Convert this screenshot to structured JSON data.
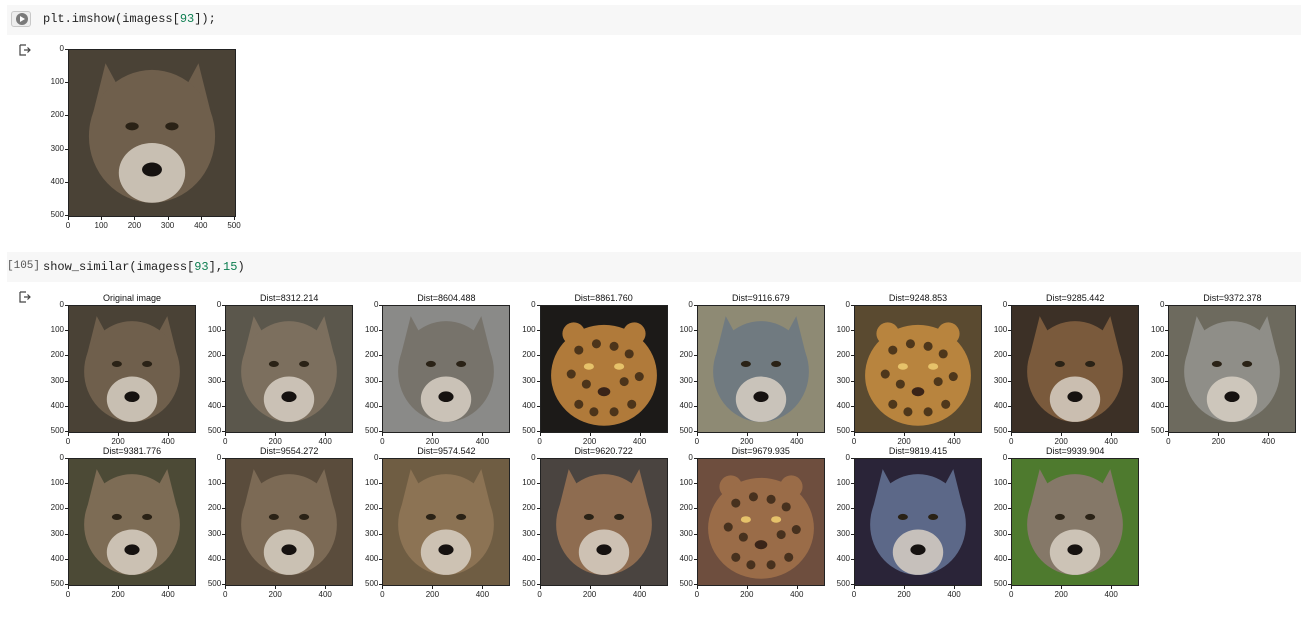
{
  "cells": [
    {
      "exec_count": "",
      "code": {
        "fn": "plt.imshow(imagess[",
        "num": "93",
        "rest": "]);"
      },
      "output": {
        "y_ticks": [
          "0",
          "100",
          "200",
          "300",
          "400",
          "500"
        ],
        "x_ticks": [
          "0",
          "100",
          "200",
          "300",
          "400",
          "500"
        ]
      }
    },
    {
      "exec_count": "[105]",
      "code": {
        "fn": "show_similar(imagess[",
        "num": "93",
        "mid": "],",
        "num2": "15",
        "rest": ")"
      },
      "output": {
        "y_ticks": [
          "0",
          "100",
          "200",
          "300",
          "400",
          "500"
        ],
        "x_ticks": [
          "0",
          "200",
          "400"
        ],
        "panels": [
          {
            "title": "Original image",
            "animal": "wolf",
            "fur": "#6f5f4c",
            "bg": "#4a4236"
          },
          {
            "title": "Dist=8312.214",
            "animal": "wolf",
            "fur": "#7c6f5e",
            "bg": "#5b574c"
          },
          {
            "title": "Dist=8604.488",
            "animal": "wolf",
            "fur": "#77736b",
            "bg": "#8a8a88"
          },
          {
            "title": "Dist=8861.760",
            "animal": "jaguar",
            "fur": "#b07a3a",
            "bg": "#1c1a18"
          },
          {
            "title": "Dist=9116.679",
            "animal": "wolf",
            "fur": "#707a80",
            "bg": "#8e8a74"
          },
          {
            "title": "Dist=9248.853",
            "animal": "leopard",
            "fur": "#b8843e",
            "bg": "#5a4a30"
          },
          {
            "title": "Dist=9285.442",
            "animal": "wolf",
            "fur": "#7a5a3c",
            "bg": "#3c3026"
          },
          {
            "title": "Dist=9372.378",
            "animal": "wolf",
            "fur": "#8f8e88",
            "bg": "#6d6a5e"
          },
          {
            "title": "Dist=9381.776",
            "animal": "wolf",
            "fur": "#7d6c55",
            "bg": "#4c4a36"
          },
          {
            "title": "Dist=9554.272",
            "animal": "wolf",
            "fur": "#7c6a55",
            "bg": "#5a4c3c"
          },
          {
            "title": "Dist=9574.542",
            "animal": "wolf",
            "fur": "#8c7354",
            "bg": "#6f5d43"
          },
          {
            "title": "Dist=9620.722",
            "animal": "wolf",
            "fur": "#8e6c50",
            "bg": "#4a4440"
          },
          {
            "title": "Dist=9679.935",
            "animal": "jaguar",
            "fur": "#9a6c48",
            "bg": "#6e4e3e"
          },
          {
            "title": "Dist=9819.415",
            "animal": "wolf",
            "fur": "#5c6888",
            "bg": "#2a2438"
          },
          {
            "title": "Dist=9939.904",
            "animal": "wolf",
            "fur": "#857868",
            "bg": "#4e7a2e"
          }
        ]
      }
    }
  ]
}
